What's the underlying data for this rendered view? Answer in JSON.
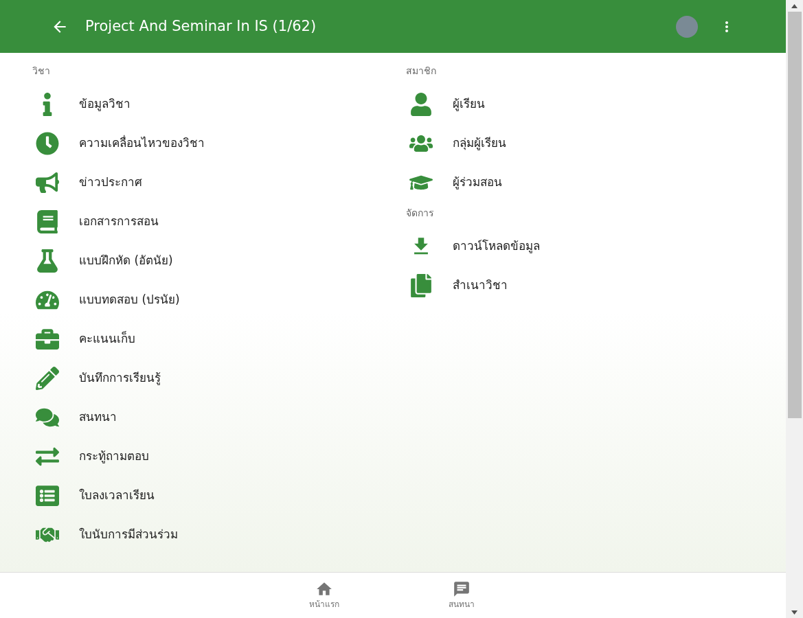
{
  "app_bar": {
    "title": "Project And Seminar In IS (1/62)"
  },
  "columns": [
    {
      "sections": [
        {
          "heading": "วิชา",
          "items": [
            {
              "label": "ข้อมูลวิชา"
            },
            {
              "label": "ความเคลื่อนไหวของวิชา"
            },
            {
              "label": "ข่าวประกาศ"
            },
            {
              "label": "เอกสารการสอน"
            },
            {
              "label": "แบบฝึกหัด (อัตนัย)"
            },
            {
              "label": "แบบทดสอบ (ปรนัย)"
            },
            {
              "label": "คะแนนเก็บ"
            },
            {
              "label": "บันทึกการเรียนรู้"
            },
            {
              "label": "สนทนา"
            },
            {
              "label": "กระทู้ถามตอบ"
            },
            {
              "label": "ใบลงเวลาเรียน"
            },
            {
              "label": "ใบนับการมีส่วนร่วม"
            }
          ]
        }
      ]
    },
    {
      "sections": [
        {
          "heading": "สมาชิก",
          "items": [
            {
              "label": "ผู้เรียน"
            },
            {
              "label": "กลุ่มผู้เรียน"
            },
            {
              "label": "ผู้ร่วมสอน"
            }
          ]
        },
        {
          "heading": "จัดการ",
          "items": [
            {
              "label": "ดาวน์โหลดข้อมูล"
            },
            {
              "label": "สำเนาวิชา"
            }
          ]
        }
      ]
    }
  ],
  "bottom_nav": [
    {
      "label": "หน้าแรก"
    },
    {
      "label": "สนทนา"
    }
  ]
}
